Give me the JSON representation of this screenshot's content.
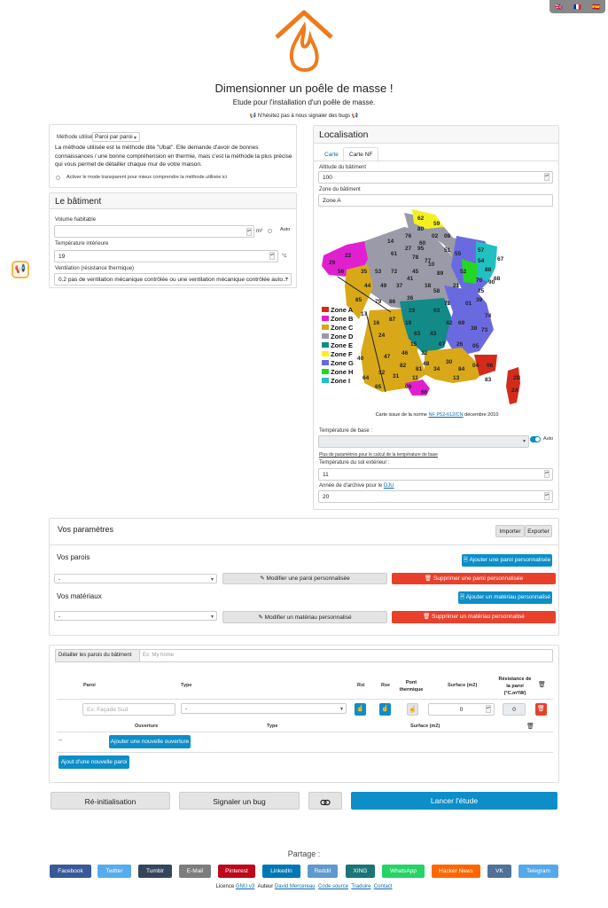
{
  "lang_flags": [
    "🇬🇧",
    "🇫🇷",
    "🇪🇸"
  ],
  "header": {
    "title": "Dimensionner un poêle de masse !",
    "subtitle": "Etude pour l'installation d'un poêle de masse.",
    "bug_note": "N'hésitez pas à nous signaler des bugs"
  },
  "method": {
    "label": "Méthode utilisé",
    "value": "Paroi par paroi",
    "desc": "La méthode utilisée est la méthode dite \"Ubat\". Elle demande d'avoir de bonnes connaissances / une bonne compréhension en thermie, mais c'est la méthode la plus précise qui vous permet de détailler chaque mur de votre maison.",
    "transparent": "Activer le mode transparent pour mieux comprendre la méthode utilisée ici"
  },
  "batiment": {
    "title": "Le bâtiment",
    "volume_label": "Volume habitable",
    "volume_unit": "m³",
    "auto": "Auto",
    "temp_label": "Température intérieure",
    "temp_value": "19",
    "temp_unit": "°c",
    "vent_label": "Ventilation (résistance thermique)",
    "vent_value": "0.2 pas de ventilation mécanique contrôlée ou une ventilation mécanique contrôlée auto..."
  },
  "localisation": {
    "title": "Localisation",
    "tab1": "Carte",
    "tab2": "Carte NF",
    "alt_label": "Altitude du bâtiment",
    "alt_value": "100",
    "zone_label": "Zone du bâtiment",
    "zone_value": "Zone A",
    "caption_pre": "Carte issue de la norme",
    "caption_link": "NF P52-612/CN",
    "caption_post": "décembre 2010",
    "base_label": "Température de base :",
    "auto": "Auto",
    "more": "Plus de paramètres pour le calcul de la température de base",
    "sol_label": "Température du sol extérieur :",
    "sol_value": "11",
    "archive_label": "Année de d'archive pour le",
    "archive_link": "DJU",
    "archive_value": "20"
  },
  "zones": [
    {
      "name": "Zone A",
      "color": "#d42a1a"
    },
    {
      "name": "Zone B",
      "color": "#e020d0"
    },
    {
      "name": "Zone C",
      "color": "#d8a818"
    },
    {
      "name": "Zone D",
      "color": "#9a9aa8"
    },
    {
      "name": "Zone E",
      "color": "#118a88"
    },
    {
      "name": "Zone F",
      "color": "#f4f020"
    },
    {
      "name": "Zone G",
      "color": "#6a6ae0"
    },
    {
      "name": "Zone H",
      "color": "#22d822"
    },
    {
      "name": "Zone I",
      "color": "#22c0c0"
    }
  ],
  "dept_labels": [
    "62",
    "59",
    "80",
    "02",
    "08",
    "76",
    "60",
    "14",
    "27",
    "95",
    "61",
    "78",
    "77",
    "51",
    "55",
    "57",
    "67",
    "54",
    "88",
    "68",
    "35",
    "53",
    "72",
    "45",
    "89",
    "10",
    "52",
    "70",
    "90",
    "29",
    "22",
    "56",
    "44",
    "49",
    "37",
    "41",
    "18",
    "58",
    "21",
    "25",
    "39",
    "85",
    "79",
    "86",
    "36",
    "71",
    "01",
    "74",
    "73",
    "17",
    "16",
    "87",
    "23",
    "03",
    "42",
    "69",
    "38",
    "24",
    "19",
    "63",
    "15",
    "43",
    "07",
    "26",
    "05",
    "47",
    "46",
    "12",
    "48",
    "30",
    "84",
    "04",
    "06",
    "40",
    "82",
    "81",
    "34",
    "13",
    "83",
    "64",
    "32",
    "31",
    "11",
    "65",
    "09",
    "66",
    "2B",
    "2A"
  ],
  "params": {
    "title": "Vos paramètres",
    "import": "Importer",
    "export": "Exporter",
    "parois_title": "Vos parois",
    "add_paroi": "Ajouter une paroi personnalisée",
    "select_paroi": "-",
    "modify_paroi": "Modifier une paroi personnalisée",
    "delete_paroi": "Supprimer une paroi personnalisée",
    "mat_title": "Vos matériaux",
    "add_mat": "Ajouter un matériau personnalisé",
    "select_mat": "-",
    "modify_mat": "Modifier un matériau personnalisé",
    "delete_mat": "Supprimer un matériau personnalisé"
  },
  "detail": {
    "label": "Détailler les parois du bâtiment",
    "placeholder": "Ex: My home",
    "headers": {
      "paroi": "Paroi",
      "type": "Type",
      "rsi": "Rsi",
      "rse": "Rse",
      "pont": "Pont thermique",
      "surface": "Surface (m2)",
      "resistance": "Résistance de la paroi (°C.m²/W)"
    },
    "row": {
      "paroi_placeholder": "Ex: Façade Sud",
      "type": "-",
      "surface": "0",
      "resistance": "0"
    },
    "ouv_headers": {
      "ouverture": "Ouverture",
      "type": "Type",
      "surface": "Surface (m2)"
    },
    "ouv_dash": "--",
    "add_ouv": "Ajouter une nouvelle ouverture",
    "add_paroi": "Ajout d'une nouvelle paroi"
  },
  "actions": {
    "reset": "Ré-initialisation",
    "bug": "Signaler un bug",
    "start": "Lancer l'étude"
  },
  "share": {
    "title": "Partage :",
    "items": [
      {
        "label": "Facebook",
        "color": "#3b5998"
      },
      {
        "label": "Twitter",
        "color": "#55acee"
      },
      {
        "label": "Tumblr",
        "color": "#35465c"
      },
      {
        "label": "E-Mail",
        "color": "#7d7d7d"
      },
      {
        "label": "Pinterest",
        "color": "#bd081c"
      },
      {
        "label": "LinkedIn",
        "color": "#0077b5"
      },
      {
        "label": "Reddit",
        "color": "#5f99cf"
      },
      {
        "label": "XING",
        "color": "#1a7576"
      },
      {
        "label": "WhatsApp",
        "color": "#25d366"
      },
      {
        "label": "Hacker News",
        "color": "#ff6600"
      },
      {
        "label": "VK",
        "color": "#507299"
      },
      {
        "label": "Telegram",
        "color": "#54a9eb"
      }
    ]
  },
  "footer": {
    "licence": "Licence",
    "gnu": "GNU v3",
    "auteur": "Auteur",
    "author": "David Mercereau",
    "source": "Code source",
    "traduire": "Traduire",
    "contact": "Contact"
  }
}
